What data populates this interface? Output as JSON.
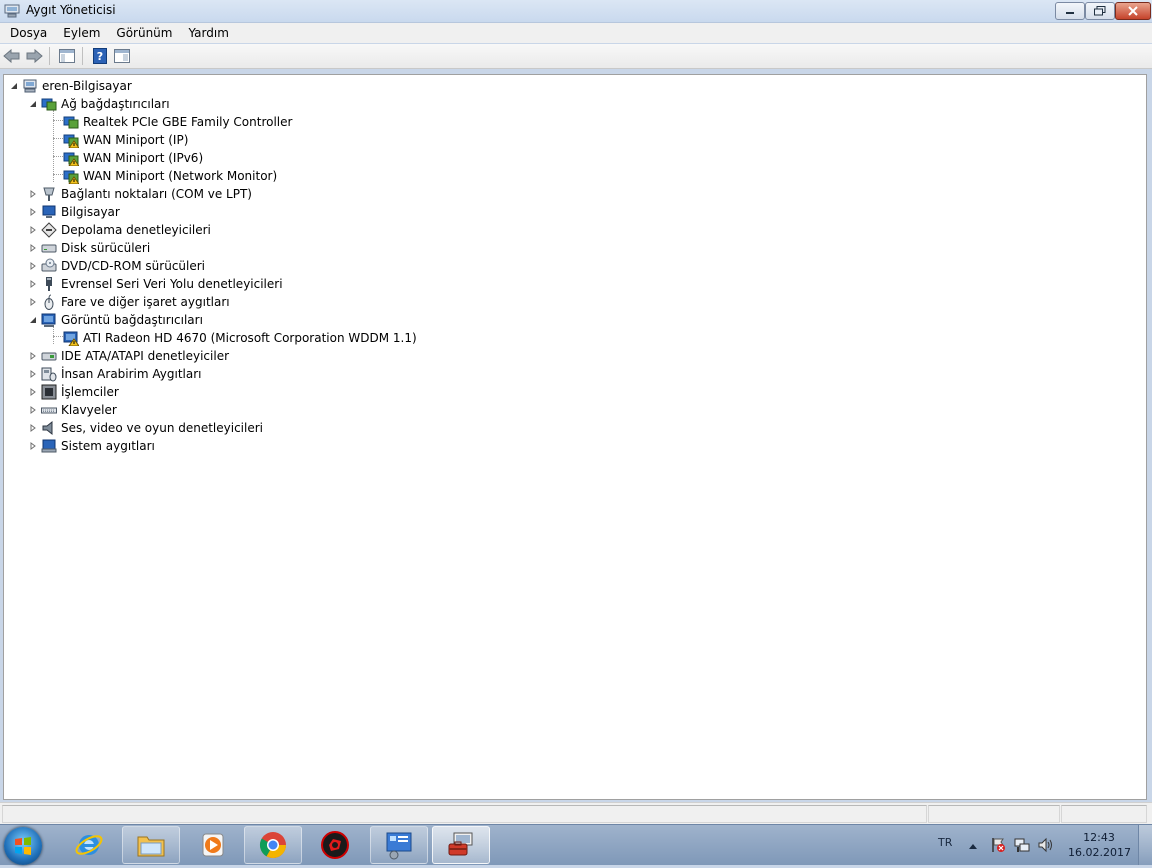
{
  "window": {
    "title": "Aygıt Yöneticisi"
  },
  "menu": [
    "Dosya",
    "Eylem",
    "Görünüm",
    "Yardım"
  ],
  "toolbar": {
    "buttons": [
      "back-arrow-icon",
      "forward-arrow-icon",
      "properties-pane-icon",
      "help-icon",
      "show-hide-console-tree-icon"
    ]
  },
  "tree": {
    "root": "eren-Bilgisayar",
    "network": {
      "label": "Ağ bağdaştırıcıları",
      "children": [
        "Realtek PCIe GBE Family Controller",
        "WAN Miniport (IP)",
        "WAN Miniport (IPv6)",
        "WAN Miniport (Network Monitor)"
      ]
    },
    "ports": "Bağlantı noktaları (COM ve LPT)",
    "computer": "Bilgisayar",
    "storage": "Depolama denetleyicileri",
    "disk": "Disk sürücüleri",
    "dvd": "DVD/CD-ROM sürücüleri",
    "usb": "Evrensel Seri Veri Yolu denetleyicileri",
    "mouse": "Fare ve diğer işaret aygıtları",
    "display": {
      "label": "Görüntü bağdaştırıcıları",
      "children": [
        "ATI Radeon HD 4670 (Microsoft Corporation WDDM 1.1)"
      ]
    },
    "ide": "IDE ATA/ATAPI denetleyiciler",
    "hid": "İnsan Arabirim Aygıtları",
    "cpu": "İşlemciler",
    "keyboard": "Klavyeler",
    "sound": "Ses, video ve oyun denetleyicileri",
    "system": "Sistem aygıtları"
  },
  "taskbar": {
    "apps": [
      "internet-explorer-icon",
      "file-explorer-icon",
      "media-player-icon",
      "chrome-icon",
      "game-booster-icon",
      "control-panel-icon",
      "device-manager-icon"
    ],
    "tray": {
      "language": "TR",
      "time": "12:43",
      "date": "16.02.2017"
    }
  },
  "colors": {
    "warning": "#f3c31c",
    "accent_blue": "#2a64b8"
  }
}
